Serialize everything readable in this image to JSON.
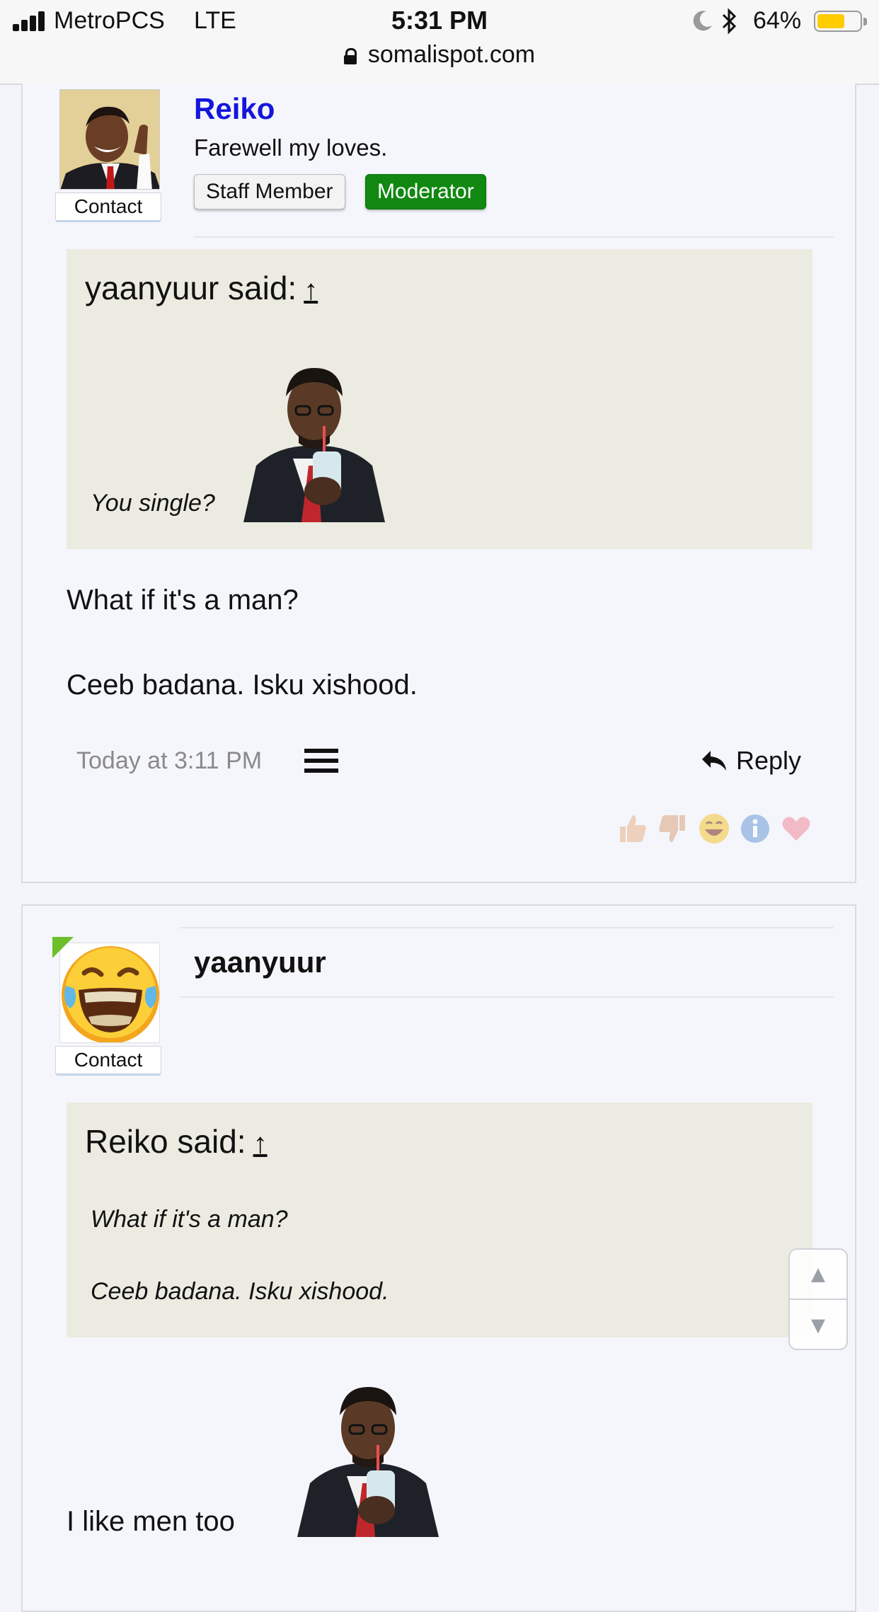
{
  "status": {
    "carrier": "MetroPCS",
    "network": "LTE",
    "time": "5:31 PM",
    "battery": "64%",
    "battery_level": 0.64,
    "url": "somalispot.com"
  },
  "post1": {
    "contact": "Contact",
    "username": "Reiko",
    "tagline": "Farewell my loves.",
    "badges": [
      "Staff Member",
      "Moderator"
    ],
    "quote": {
      "author": "yaanyuur said:",
      "up": "↑",
      "text": "You single?"
    },
    "body": [
      "What if it's a man?",
      "Ceeb badana. Isku xishood."
    ],
    "timestamp": "Today at 3:11 PM",
    "reply": "Reply",
    "reactions": [
      "like-icon",
      "dislike-icon",
      "laugh-icon",
      "info-icon",
      "heart-icon"
    ]
  },
  "post2": {
    "contact": "Contact",
    "username": "yaanyuur",
    "quote": {
      "author": "Reiko said:",
      "up": "↑",
      "lines": [
        "What if it's a man?",
        "Ceeb badana. Isku xishood."
      ]
    },
    "body": "I like men too"
  },
  "scroller": {
    "up": "▲",
    "down": "▼"
  }
}
